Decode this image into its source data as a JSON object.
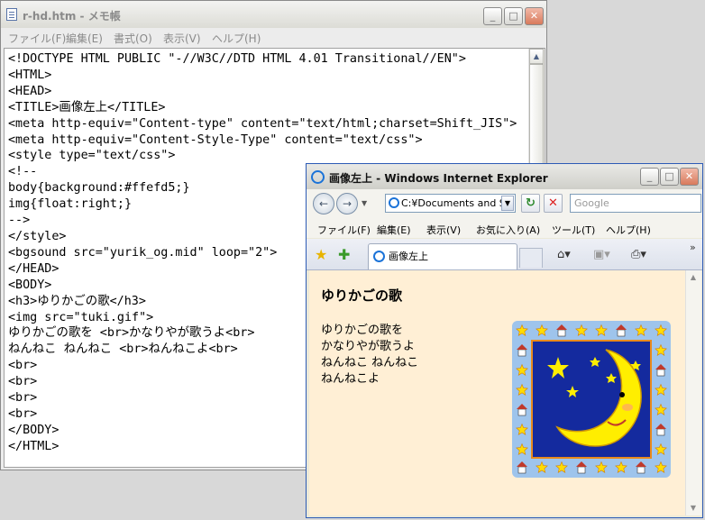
{
  "notepad": {
    "title": "r-hd.htm - メモ帳",
    "menu": [
      "ファイル(F)",
      "編集(E)",
      "書式(O)",
      "表示(V)",
      "ヘルプ(H)"
    ],
    "lines": [
      "<!DOCTYPE HTML PUBLIC \"-//W3C//DTD HTML 4.01 Transitional//EN\">",
      "<HTML>",
      "<HEAD>",
      "<TITLE>画像左上</TITLE>",
      "<meta http-equiv=\"Content-type\" content=\"text/html;charset=Shift_JIS\">",
      "<meta http-equiv=\"Content-Style-Type\" content=\"text/css\">",
      "<style type=\"text/css\">",
      "<!--",
      "body{background:#ffefd5;}",
      "img{float:right;}",
      "-->",
      "</style>",
      "<bgsound src=\"yurik_og.mid\" loop=\"2\">",
      "</HEAD>",
      "<BODY>",
      "<h3>ゆりかごの歌</h3>",
      "<img src=\"tuki.gif\">",
      "ゆりかごの歌を <br>かなりやが歌うよ<br>",
      "ねんねこ ねんねこ <br>ねんねこよ<br>",
      "<br>",
      "<br>",
      "<br>",
      "<br>",
      "</BODY>",
      "</HTML>"
    ]
  },
  "ie": {
    "title": "画像左上 - Windows Internet Explorer",
    "address": "C:¥Documents and S",
    "search_placeholder": "Google",
    "menu": [
      "ファイル(F)",
      "編集(E)",
      "表示(V)",
      "お気に入り(A)",
      "ツール(T)",
      "ヘルプ(H)"
    ],
    "tab_label": "画像左上",
    "page": {
      "heading": "ゆりかごの歌",
      "lines": [
        "ゆりかごの歌を",
        "かなりやが歌うよ",
        "ねんねこ ねんねこ",
        "ねんねこよ"
      ]
    }
  },
  "colors": {
    "page_background": "#ffefd5",
    "moon_frame": "#9ec4ec",
    "moon_sky": "#142a9e",
    "moon_yellow": "#ffee00"
  }
}
